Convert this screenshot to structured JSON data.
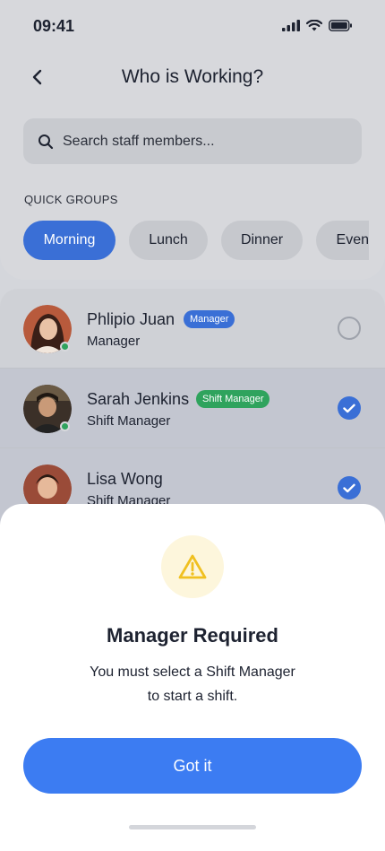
{
  "status": {
    "time": "09:41"
  },
  "header": {
    "title": "Who is Working?"
  },
  "search": {
    "placeholder": "Search staff members..."
  },
  "quick_groups": {
    "label": "QUICK GROUPS",
    "chips": [
      "Morning",
      "Lunch",
      "Dinner",
      "Event"
    ],
    "active": "Morning"
  },
  "staff": [
    {
      "name": "Phlipio Juan",
      "badge": "Manager",
      "badge_color": "#3a6fd6",
      "role": "Manager",
      "selected": false,
      "online": true
    },
    {
      "name": "Sarah Jenkins",
      "badge": "Shift Manager",
      "badge_color": "#2fa35d",
      "role": "Shift Manager",
      "selected": true,
      "online": true
    },
    {
      "name": "Lisa Wong",
      "badge": "",
      "role": "Shift Manager",
      "selected": true,
      "online": false
    }
  ],
  "dialog": {
    "icon": "warning-icon",
    "title": "Manager Required",
    "message": "You must select a Shift Manager to start a shift.",
    "button": "Got it"
  },
  "colors": {
    "accent": "#3a6fd6",
    "button": "#3c7cf2",
    "online": "#2fa35d",
    "warning": "#f0c020"
  }
}
